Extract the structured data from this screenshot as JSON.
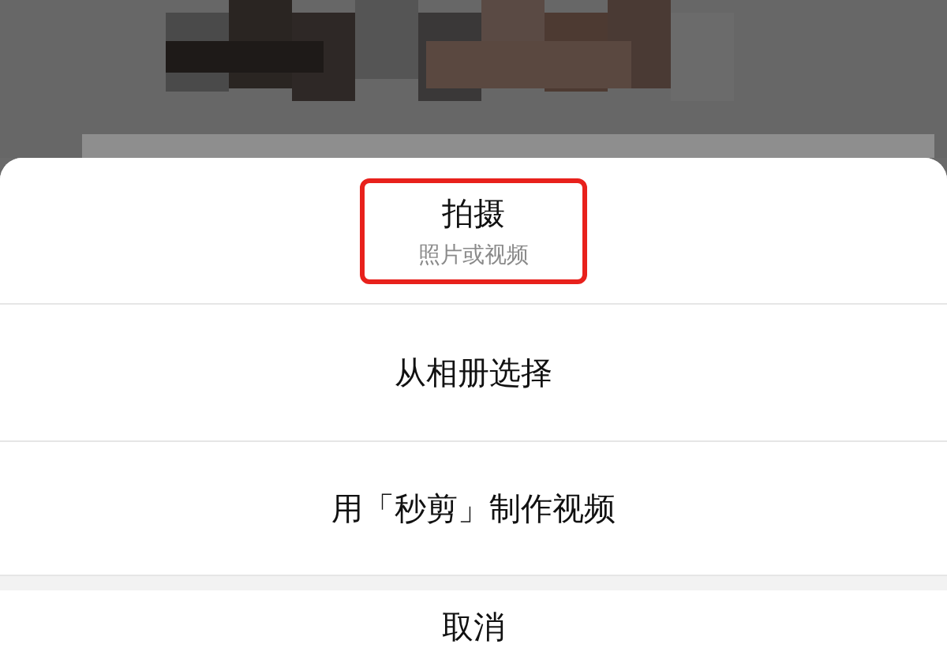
{
  "action_sheet": {
    "options": [
      {
        "label": "拍摄",
        "subtitle": "照片或视频",
        "highlighted": true
      },
      {
        "label": "从相册选择",
        "highlighted": false
      },
      {
        "label": "用「秒剪」制作视频",
        "highlighted": false
      }
    ],
    "cancel": {
      "label": "取消"
    }
  }
}
